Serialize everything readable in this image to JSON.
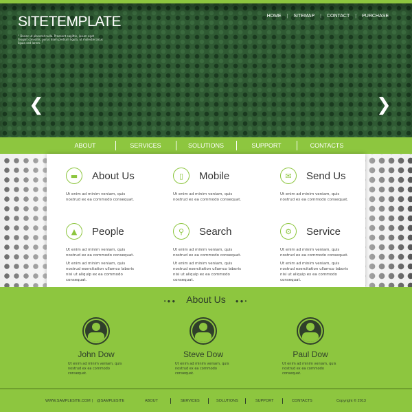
{
  "colors": {
    "accent": "#8dc63f",
    "hero_bg": "#2f5a33",
    "dark_text": "#2f3f2a"
  },
  "header": {
    "logo": "SITETEMPLATE",
    "tagline": "“ Donec ut placerat nulla. Praesent sagittis, ipsum eget feugiat convallis, purus diam pretium ligula, ut molestie lacus ligula sed lorem. ”",
    "top_nav": [
      "HOME",
      "SITEMAP",
      "CONTACT",
      "PURCHASE"
    ],
    "prev_icon": "chevron-left-icon",
    "next_icon": "chevron-right-icon",
    "prev": "❮",
    "next": "❯"
  },
  "nav": [
    "ABOUT",
    "SERVICES",
    "SOLUTIONS",
    "SUPPORT",
    "CONTACTS"
  ],
  "features": [
    {
      "title": "About Us",
      "icon": "book-icon",
      "glyph": "▬",
      "texts": [
        "Ut enim ad minim veniam, quis nostrud ex ea commodo consequat."
      ]
    },
    {
      "title": "Mobile",
      "icon": "mobile-icon",
      "glyph": "▯",
      "texts": [
        "Ut enim ad minim veniam, quis nostrud ex ea commodo consequat."
      ]
    },
    {
      "title": "Send Us",
      "icon": "envelope-icon",
      "glyph": "✉",
      "texts": [
        "Ut enim ad minim veniam, quis nostrud ex ea commodo consequat."
      ]
    },
    {
      "title": "People",
      "icon": "people-icon",
      "glyph": "▲",
      "texts": [
        "Ut enim ad minim veniam, quis nostrud ex ea commodo consequat.",
        "Ut enim ad minim veniam, quis nostrud exercitation ullamco laboris nisi ut aliquip ex ea commodo consequat."
      ]
    },
    {
      "title": "Search",
      "icon": "search-icon",
      "glyph": "⚲",
      "texts": [
        "Ut enim ad minim veniam, quis nostrud ex ea commodo consequat.",
        "Ut enim ad minim veniam, quis nostrud exercitation ullamco laboris nisi ut aliquip ex ea commodo consequat."
      ]
    },
    {
      "title": "Service",
      "icon": "gear-icon",
      "glyph": "⚙",
      "texts": [
        "Ut enim ad minim veniam, quis nostrud ex ea commodo consequat.",
        "Ut enim ad minim veniam, quis nostrud exercitation ullamco laboris nisi ut aliquip ex ea commodo consequat."
      ]
    }
  ],
  "about": {
    "title": "About Us",
    "deco_left": "•●●",
    "deco_right": "●●•",
    "people": [
      {
        "name": "John Dow",
        "text": "Ut enim ad minim veniam, quis nostrud ex ea commodo consequat."
      },
      {
        "name": "Steve Dow",
        "text": "Ut enim ad minim veniam, quis nostrud ex ea commodo consequat."
      },
      {
        "name": "Paul Dow",
        "text": "Ut enim ad minim veniam, quis nostrud ex ea commodo consequat."
      }
    ]
  },
  "footer": {
    "website": "WWW.SAMPLESITE.COM",
    "handle": "@SAMPLESITE",
    "sep": "|",
    "links": [
      "ABOUT",
      "SERVICES",
      "SOLUTIONS",
      "SUPPORT",
      "CONTACTS"
    ],
    "copyright": "Copyright © 2013"
  }
}
